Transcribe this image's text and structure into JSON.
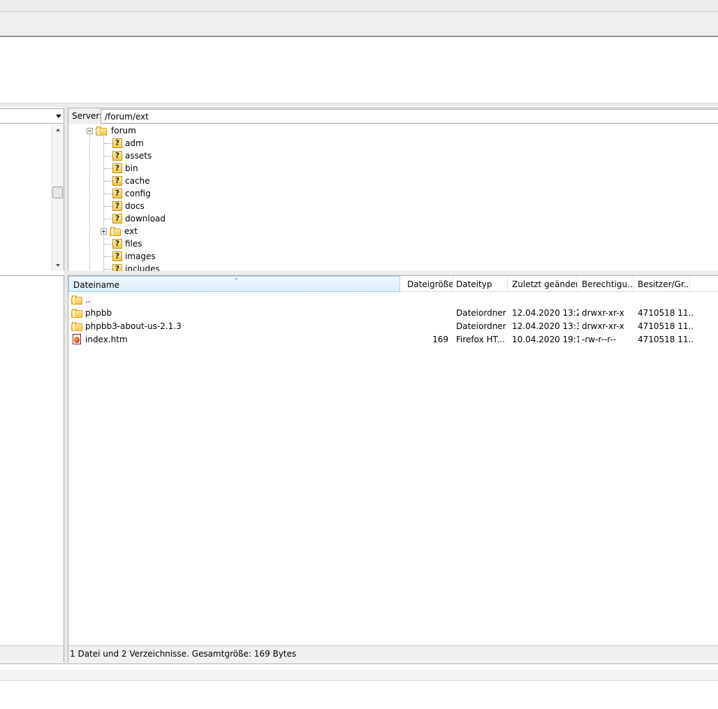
{
  "server_bar": {
    "label": "Server:",
    "path": "/forum/ext"
  },
  "server_tree": {
    "root": {
      "label": "forum",
      "icon": "folder-icon",
      "expanded": true
    },
    "children": [
      {
        "label": "adm",
        "icon": "question-folder-icon"
      },
      {
        "label": "assets",
        "icon": "question-folder-icon"
      },
      {
        "label": "bin",
        "icon": "question-folder-icon"
      },
      {
        "label": "cache",
        "icon": "question-folder-icon"
      },
      {
        "label": "config",
        "icon": "question-folder-icon"
      },
      {
        "label": "docs",
        "icon": "question-folder-icon"
      },
      {
        "label": "download",
        "icon": "question-folder-icon"
      },
      {
        "label": "ext",
        "icon": "folder-icon",
        "expandable": true
      },
      {
        "label": "files",
        "icon": "question-folder-icon"
      },
      {
        "label": "images",
        "icon": "question-folder-icon"
      },
      {
        "label": "includes",
        "icon": "question-folder-icon"
      }
    ]
  },
  "file_list": {
    "columns": [
      "Dateiname",
      "Dateigröße",
      "Dateityp",
      "Zuletzt geändert",
      "Berechtigu...",
      "Besitzer/Gr..."
    ],
    "sort_indicator": "^",
    "rows": [
      {
        "name": "..",
        "size": "",
        "type": "",
        "modified": "",
        "permissions": "",
        "owner": "",
        "icon": "folder-icon"
      },
      {
        "name": "phpbb",
        "size": "",
        "type": "Dateiordner",
        "modified": "12.04.2020 13:2...",
        "permissions": "drwxr-xr-x",
        "owner": "4710518 11...",
        "icon": "folder-icon"
      },
      {
        "name": "phpbb3-about-us-2.1.3",
        "size": "",
        "type": "Dateiordner",
        "modified": "12.04.2020 13:3...",
        "permissions": "drwxr-xr-x",
        "owner": "4710518 11...",
        "icon": "folder-icon"
      },
      {
        "name": "index.htm",
        "size": "169",
        "type": "Firefox HT...",
        "modified": "10.04.2020 19:1...",
        "permissions": "-rw-r--r--",
        "owner": "4710518 11...",
        "icon": "html-file-icon"
      }
    ]
  },
  "status_bar": {
    "text": "1 Datei und 2 Verzeichnisse. Gesamtgröße: 169 Bytes"
  },
  "colors": {
    "sorted_header_bg": "#dbeefb",
    "sorted_header_border": "#9fd0ef",
    "folder": "#f6c84c",
    "panel_bg": "#f0f0f0"
  }
}
